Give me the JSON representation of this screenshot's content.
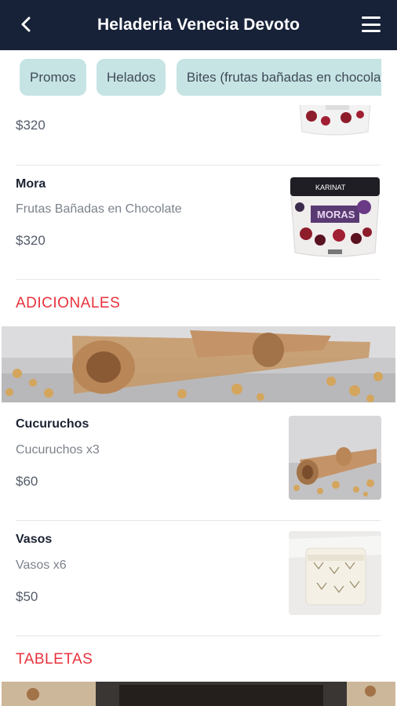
{
  "header": {
    "title": "Heladeria Venecia Devoto",
    "back_icon": "chevron-left-icon",
    "menu_icon": "hamburger-menu-icon"
  },
  "tabs": [
    {
      "label": "Promos"
    },
    {
      "label": "Helados"
    },
    {
      "label": "Bites (frutas bañadas en chocolat"
    }
  ],
  "items_prev": {
    "price": "$320"
  },
  "items": [
    {
      "name": "Mora",
      "description": "Frutas Bañadas en Chocolate",
      "price": "$320",
      "image_text": "KARINAT",
      "image_label": "MORAS"
    },
    {
      "name": "Cucuruchos",
      "description": "Cucuruchos x3",
      "price": "$60"
    },
    {
      "name": "Vasos",
      "description": "Vasos x6",
      "price": "$50"
    }
  ],
  "sections": {
    "adicionales": "ADICIONALES",
    "tabletas": "TABLETAS"
  },
  "colors": {
    "header_bg": "#172238",
    "tab_bg": "#c6e4e4",
    "section_red": "#e8323c"
  }
}
